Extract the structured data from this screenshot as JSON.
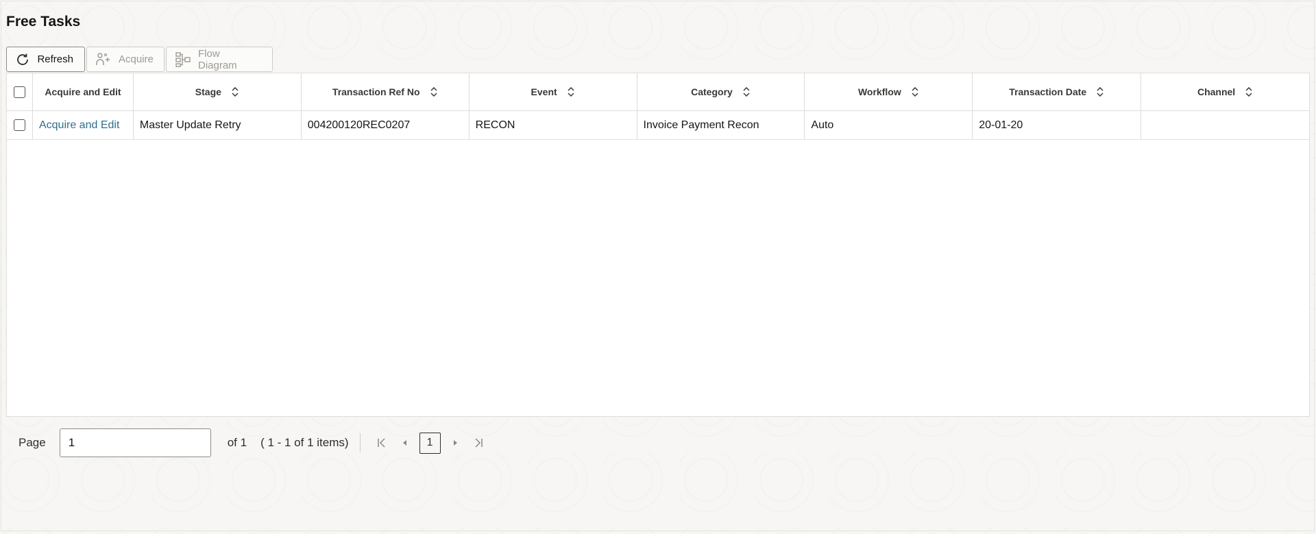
{
  "page": {
    "title": "Free Tasks"
  },
  "toolbar": {
    "refresh_label": "Refresh",
    "acquire_label": "Acquire",
    "flow_label": "Flow Diagram"
  },
  "table": {
    "columns": [
      {
        "label": "Acquire and Edit",
        "sortable": false
      },
      {
        "label": "Stage",
        "sortable": true
      },
      {
        "label": "Transaction Ref No",
        "sortable": true
      },
      {
        "label": "Event",
        "sortable": true
      },
      {
        "label": "Category",
        "sortable": true
      },
      {
        "label": "Workflow",
        "sortable": true
      },
      {
        "label": "Transaction Date",
        "sortable": true
      },
      {
        "label": "Channel",
        "sortable": true
      }
    ],
    "rows": [
      {
        "action": "Acquire and Edit",
        "stage": "Master Update Retry",
        "ref_no": "004200120REC0207",
        "event": "RECON",
        "category": "Invoice Payment Recon",
        "workflow": "Auto",
        "date": "20-01-20",
        "channel": ""
      }
    ]
  },
  "pager": {
    "page_label": "Page",
    "page_value": "1",
    "of_text": "of 1",
    "items_text": "( 1 - 1 of 1 items)",
    "current_page": "1"
  },
  "colors": {
    "link": "#2e6e8e",
    "border": "#dedcd8"
  },
  "icons": [
    "refresh-icon",
    "acquire-icon",
    "flow-diagram-icon",
    "sort-icon",
    "first-page-icon",
    "prev-page-icon",
    "next-page-icon",
    "last-page-icon"
  ]
}
